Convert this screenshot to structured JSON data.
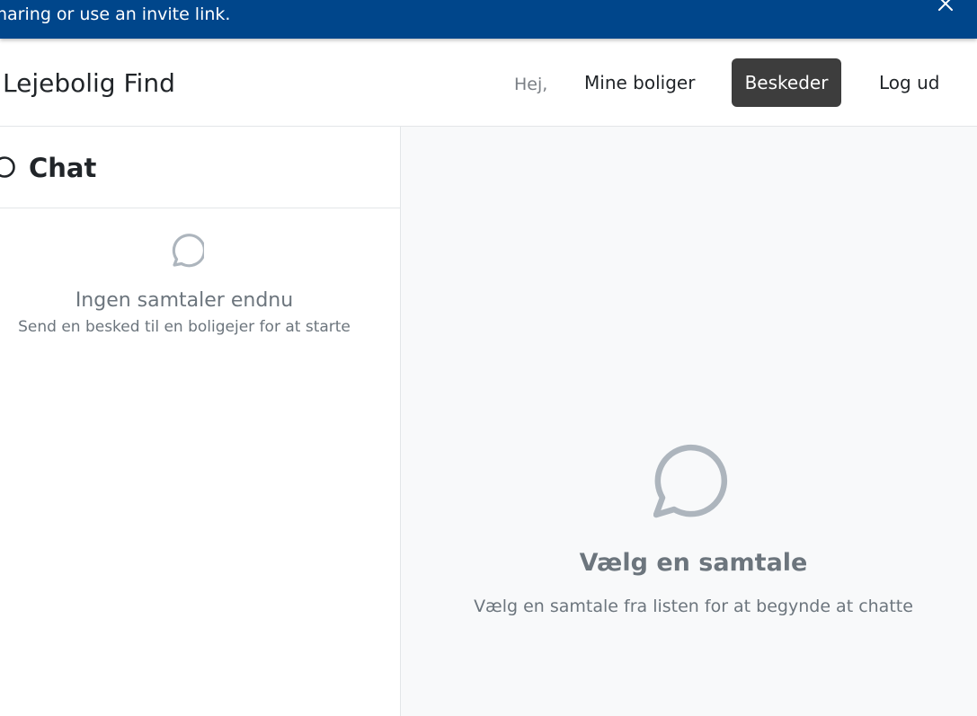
{
  "banner": {
    "text": "haring or use an invite link.",
    "close_icon": "close-icon"
  },
  "navbar": {
    "brand": "Lejebolig Find",
    "greeting": "Hej,",
    "links": {
      "mine_boliger": "Mine boliger",
      "beskeder": "Beskeder",
      "log_ud": "Log ud"
    },
    "active_link": "Beskeder",
    "active_color": "#3d3d3d"
  },
  "chat_list": {
    "title": "Chat",
    "icon": "chat-bubble-icon",
    "empty_title": "Ingen samtaler endnu",
    "empty_subtitle": "Send en besked til en boligejer for at starte"
  },
  "conversation": {
    "icon": "chat-bubble-icon",
    "empty_title": "Vælg en samtale",
    "empty_subtitle": "Vælg en samtale fra listen for at begynde at chatte"
  },
  "colors": {
    "banner_bg": "#00468b",
    "muted_text": "#6c757d",
    "panel_bg": "#f8f9fa"
  }
}
